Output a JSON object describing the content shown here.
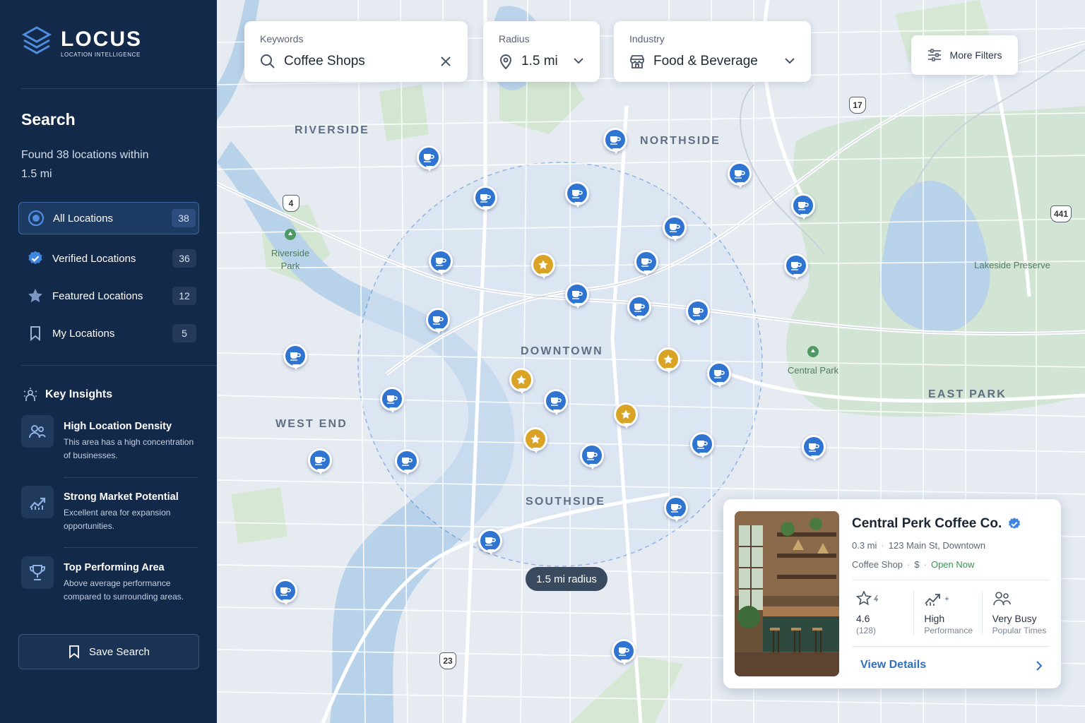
{
  "app": {
    "name": "LOCUS",
    "tagline": "LOCATION INTELLIGENCE"
  },
  "sidebar": {
    "search_title": "Search",
    "found_text": "Found 38 locations within 1.5 mi",
    "filters": [
      {
        "label": "All Locations",
        "count": "38",
        "icon": "target-icon",
        "active": true
      },
      {
        "label": "Verified Locations",
        "count": "36",
        "icon": "verified-badge-icon"
      },
      {
        "label": "Featured Locations",
        "count": "12",
        "icon": "star-icon"
      },
      {
        "label": "My Locations",
        "count": "5",
        "icon": "bookmark-icon"
      }
    ],
    "insights_title": "Key Insights",
    "insights": [
      {
        "title": "High Location Density",
        "desc": "This area has a high concentration of businesses.",
        "icon": "people-icon"
      },
      {
        "title": "Strong Market Potential",
        "desc": "Excellent area for expansion opportunities.",
        "icon": "trend-chart-icon"
      },
      {
        "title": "Top Performing Area",
        "desc": "Above average performance compared to surrounding areas.",
        "icon": "trophy-icon"
      }
    ],
    "save_label": "Save Search"
  },
  "search": {
    "keywords_label": "Keywords",
    "keywords_value": "Coffee Shops",
    "radius_label": "Radius",
    "radius_value": "1.5 mi",
    "industry_label": "Industry",
    "industry_value": "Food & Beverage",
    "more_filters": "More Filters"
  },
  "map": {
    "areas": [
      "RIVERSIDE",
      "NORTHSIDE",
      "DOWNTOWN",
      "WEST END",
      "SOUTHSIDE",
      "EAST PARK"
    ],
    "parks": [
      "Riverside Park",
      "Central Park",
      "Lakeside Preserve"
    ],
    "routes": [
      "4",
      "17",
      "441",
      "23"
    ],
    "radius_badge": "1.5 mi radius"
  },
  "card": {
    "name": "Central Perk Coffee Co.",
    "distance": "0.3 mi",
    "address": "123 Main St, Downtown",
    "category": "Coffee Shop",
    "price": "$",
    "status": "Open Now",
    "rating": "4.6",
    "reviews": "(128)",
    "performance": "High",
    "performance_sub": "Performance",
    "busy": "Very Busy",
    "busy_sub": "Popular Times",
    "view_label": "View Details"
  },
  "colors": {
    "sidebar_bg": "#13294a",
    "accent": "#2f74d0",
    "featured": "#d9a425",
    "open": "#2f9a4d"
  }
}
